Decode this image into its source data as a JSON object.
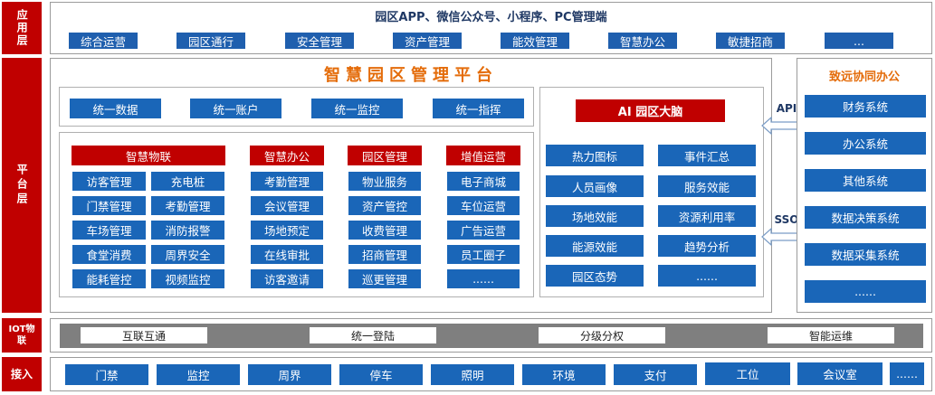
{
  "colors": {
    "red": "#c00000",
    "blue": "#1f5fae",
    "navy": "#1f3864",
    "orange": "#e46c0a",
    "gray": "#7f7f7f"
  },
  "app_layer": {
    "side_label": "应用层",
    "title": "园区APP、微信公众号、小程序、PC管理端",
    "items": [
      "综合运营",
      "园区通行",
      "安全管理",
      "资产管理",
      "能效管理",
      "智慧办公",
      "敏捷招商",
      "..."
    ]
  },
  "platform_layer": {
    "side_label": "平台层",
    "title": "智慧园区管理平台",
    "unified": [
      "统一数据",
      "统一账户",
      "统一监控",
      "统一指挥"
    ],
    "modules": {
      "wulian": {
        "header": "智慧物联",
        "left": [
          "访客管理",
          "门禁管理",
          "车场管理",
          "食堂消费",
          "能耗管控"
        ],
        "right": [
          "充电桩",
          "考勤管理",
          "消防报警",
          "周界安全",
          "视频监控"
        ]
      },
      "bangong": {
        "header": "智慧办公",
        "items": [
          "考勤管理",
          "会议管理",
          "场地预定",
          "在线审批",
          "访客邀请"
        ]
      },
      "yuanqu": {
        "header": "园区管理",
        "items": [
          "物业服务",
          "资产管控",
          "收费管理",
          "招商管理",
          "巡更管理"
        ]
      },
      "zengzhi": {
        "header": "增值运营",
        "items": [
          "电子商城",
          "车位运营",
          "广告运营",
          "员工圈子",
          "......"
        ]
      }
    },
    "ai": {
      "title": "AI 园区大脑",
      "left": [
        "热力图标",
        "人员画像",
        "场地效能",
        "能源效能",
        "园区态势"
      ],
      "right": [
        "事件汇总",
        "服务效能",
        "资源利用率",
        "趋势分析",
        "......"
      ]
    },
    "api_label": "API",
    "sso_label": "SSO",
    "office": {
      "title": "致远协同办公",
      "items": [
        "财务系统",
        "办公系统",
        "其他系统",
        "数据决策系统",
        "数据采集系统",
        "......"
      ]
    }
  },
  "iot_layer": {
    "side_label": "IOT物联",
    "items": [
      "互联互通",
      "统一登陆",
      "分级分权",
      "智能运维"
    ]
  },
  "access_layer": {
    "side_label": "接入",
    "items": [
      "门禁",
      "监控",
      "周界",
      "停车",
      "照明",
      "环境",
      "支付",
      "工位",
      "会议室",
      "......"
    ]
  }
}
